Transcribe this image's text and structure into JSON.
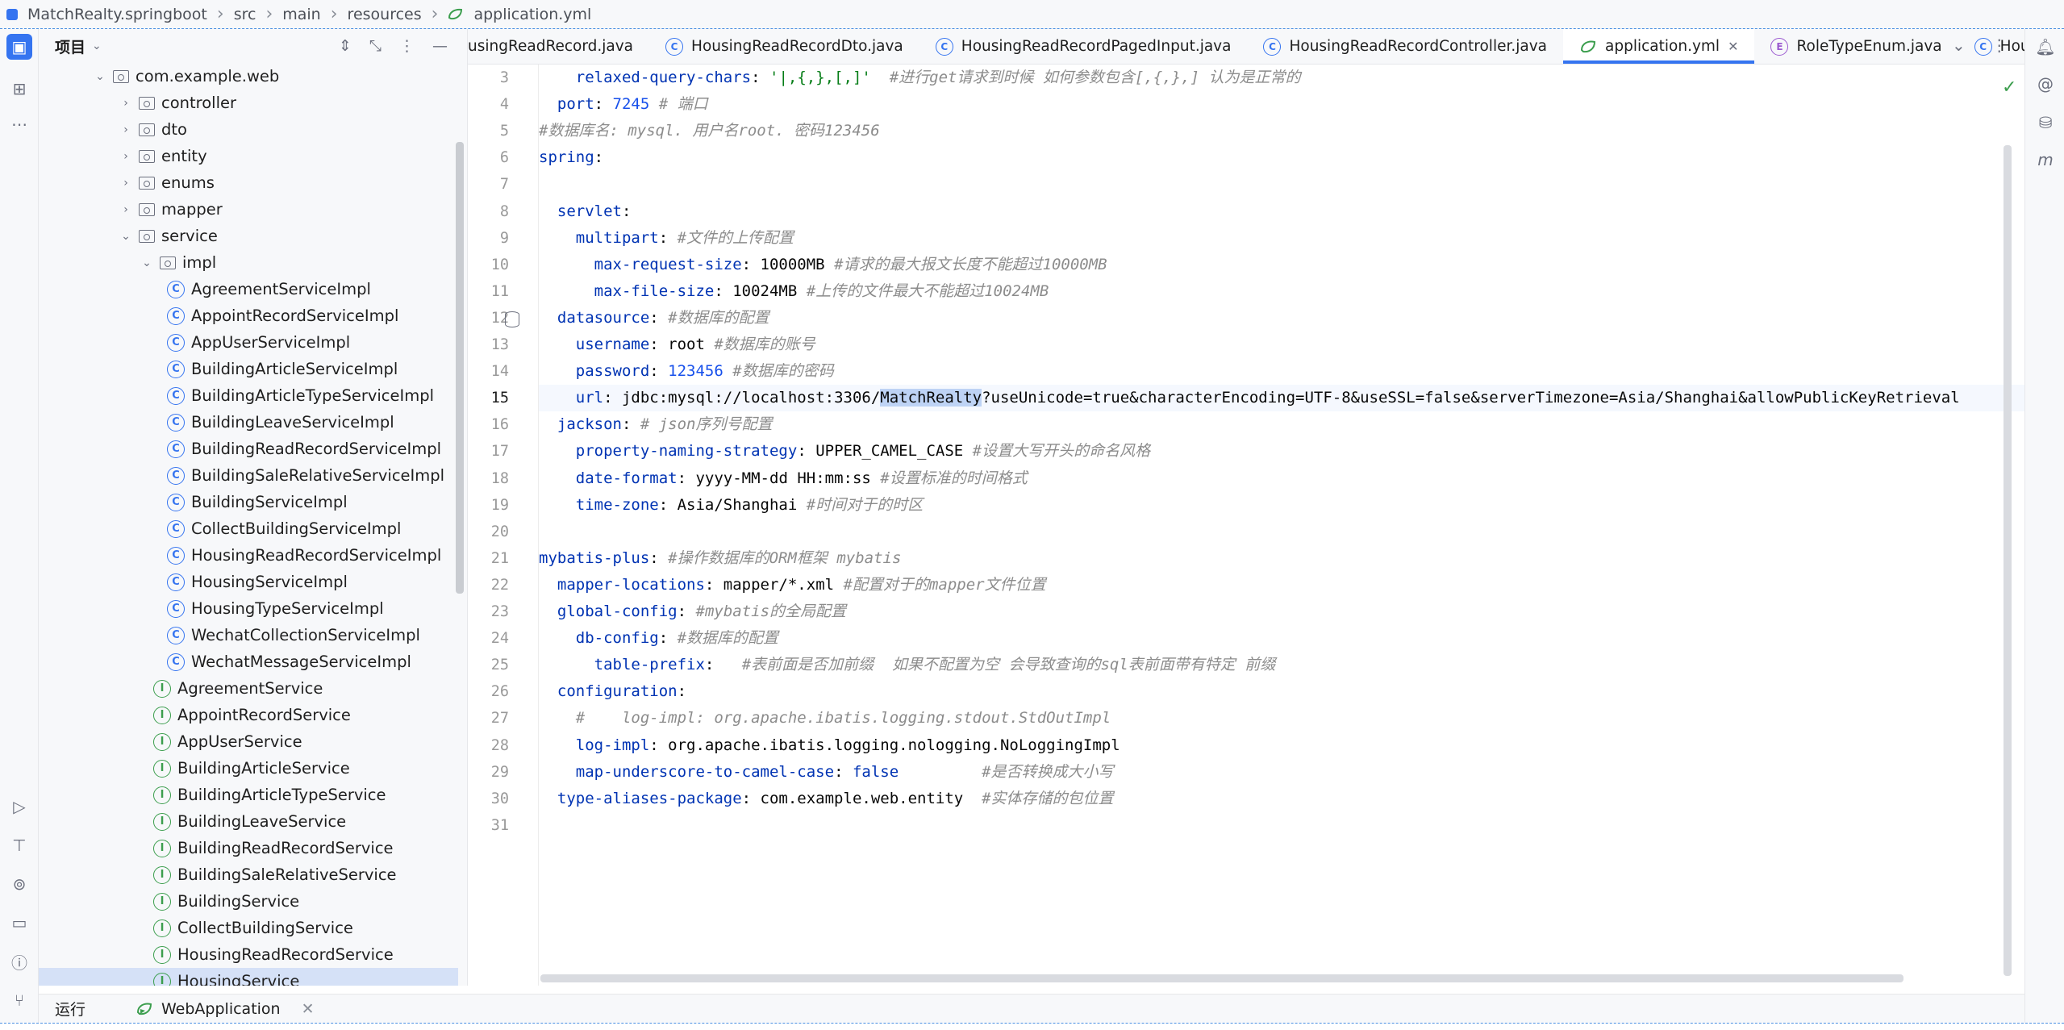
{
  "breadcrumb": [
    "MatchRealty.springboot",
    "src",
    "main",
    "resources",
    "application.yml"
  ],
  "project_panel": {
    "title": "项目",
    "tree": [
      {
        "label": "com.example.web",
        "kind": "folder",
        "depth": 0,
        "arrow": "open"
      },
      {
        "label": "controller",
        "kind": "folder",
        "depth": 1,
        "arrow": "closed"
      },
      {
        "label": "dto",
        "kind": "folder",
        "depth": 1,
        "arrow": "closed"
      },
      {
        "label": "entity",
        "kind": "folder",
        "depth": 1,
        "arrow": "closed"
      },
      {
        "label": "enums",
        "kind": "folder",
        "depth": 1,
        "arrow": "closed"
      },
      {
        "label": "mapper",
        "kind": "folder",
        "depth": 1,
        "arrow": "closed"
      },
      {
        "label": "service",
        "kind": "folder",
        "depth": 1,
        "arrow": "open"
      },
      {
        "label": "impl",
        "kind": "folder",
        "depth": 2,
        "arrow": "open"
      },
      {
        "label": "AgreementServiceImpl",
        "kind": "class",
        "depth": 3
      },
      {
        "label": "AppointRecordServiceImpl",
        "kind": "class",
        "depth": 3
      },
      {
        "label": "AppUserServiceImpl",
        "kind": "class",
        "depth": 3
      },
      {
        "label": "BuildingArticleServiceImpl",
        "kind": "class",
        "depth": 3
      },
      {
        "label": "BuildingArticleTypeServiceImpl",
        "kind": "class",
        "depth": 3
      },
      {
        "label": "BuildingLeaveServiceImpl",
        "kind": "class",
        "depth": 3
      },
      {
        "label": "BuildingReadRecordServiceImpl",
        "kind": "class",
        "depth": 3
      },
      {
        "label": "BuildingSaleRelativeServiceImpl",
        "kind": "class",
        "depth": 3
      },
      {
        "label": "BuildingServiceImpl",
        "kind": "class",
        "depth": 3
      },
      {
        "label": "CollectBuildingServiceImpl",
        "kind": "class",
        "depth": 3
      },
      {
        "label": "HousingReadRecordServiceImpl",
        "kind": "class",
        "depth": 3
      },
      {
        "label": "HousingServiceImpl",
        "kind": "class",
        "depth": 3
      },
      {
        "label": "HousingTypeServiceImpl",
        "kind": "class",
        "depth": 3
      },
      {
        "label": "WechatCollectionServiceImpl",
        "kind": "class",
        "depth": 3
      },
      {
        "label": "WechatMessageServiceImpl",
        "kind": "class",
        "depth": 3
      },
      {
        "label": "AgreementService",
        "kind": "interface",
        "depth": 2
      },
      {
        "label": "AppointRecordService",
        "kind": "interface",
        "depth": 2
      },
      {
        "label": "AppUserService",
        "kind": "interface",
        "depth": 2
      },
      {
        "label": "BuildingArticleService",
        "kind": "interface",
        "depth": 2
      },
      {
        "label": "BuildingArticleTypeService",
        "kind": "interface",
        "depth": 2
      },
      {
        "label": "BuildingLeaveService",
        "kind": "interface",
        "depth": 2
      },
      {
        "label": "BuildingReadRecordService",
        "kind": "interface",
        "depth": 2
      },
      {
        "label": "BuildingSaleRelativeService",
        "kind": "interface",
        "depth": 2
      },
      {
        "label": "BuildingService",
        "kind": "interface",
        "depth": 2
      },
      {
        "label": "CollectBuildingService",
        "kind": "interface",
        "depth": 2
      },
      {
        "label": "HousingReadRecordService",
        "kind": "interface",
        "depth": 2
      },
      {
        "label": "HousingService",
        "kind": "interface",
        "depth": 2
      }
    ]
  },
  "tabs": [
    {
      "label": "usingReadRecord.java",
      "icon": "none",
      "active": false
    },
    {
      "label": "HousingReadRecordDto.java",
      "icon": "class",
      "active": false
    },
    {
      "label": "HousingReadRecordPagedInput.java",
      "icon": "class",
      "active": false
    },
    {
      "label": "HousingReadRecordController.java",
      "icon": "class",
      "active": false
    },
    {
      "label": "application.yml",
      "icon": "yml",
      "active": true
    },
    {
      "label": "RoleTypeEnum.java",
      "icon": "enum",
      "active": false
    },
    {
      "label": "HousingController.java",
      "icon": "class",
      "active": false
    }
  ],
  "editor": {
    "current_line": 15,
    "lines": [
      {
        "n": "3",
        "parts": [
          [
            "    ",
            ""
          ],
          [
            "relaxed-query-chars",
            "k"
          ],
          [
            ": ",
            ""
          ],
          [
            "'|,{,},[,]'",
            "s"
          ],
          [
            "  ",
            ""
          ],
          [
            "#进行get请求到时候 如何参数包含[,{,},] 认为是正常的",
            "c"
          ]
        ]
      },
      {
        "n": "4",
        "parts": [
          [
            "  ",
            ""
          ],
          [
            "port",
            "k"
          ],
          [
            ": ",
            ""
          ],
          [
            "7245",
            "n"
          ],
          [
            " ",
            ""
          ],
          [
            "# 端口",
            "c"
          ]
        ]
      },
      {
        "n": "5",
        "parts": [
          [
            "#数据库名: mysql. 用户名root. 密码123456",
            "c"
          ]
        ]
      },
      {
        "n": "6",
        "parts": [
          [
            "spring",
            "k"
          ],
          [
            ":",
            ""
          ]
        ]
      },
      {
        "n": "7",
        "parts": [
          [
            "",
            ""
          ]
        ]
      },
      {
        "n": "8",
        "parts": [
          [
            "  ",
            ""
          ],
          [
            "servlet",
            "k"
          ],
          [
            ":",
            ""
          ]
        ]
      },
      {
        "n": "9",
        "parts": [
          [
            "    ",
            ""
          ],
          [
            "multipart",
            "k"
          ],
          [
            ": ",
            ""
          ],
          [
            "#文件的上传配置",
            "c"
          ]
        ]
      },
      {
        "n": "10",
        "parts": [
          [
            "      ",
            ""
          ],
          [
            "max-request-size",
            "k"
          ],
          [
            ": 10000MB ",
            ""
          ],
          [
            "#请求的最大报文长度不能超过10000MB",
            "c"
          ]
        ]
      },
      {
        "n": "11",
        "parts": [
          [
            "      ",
            ""
          ],
          [
            "max-file-size",
            "k"
          ],
          [
            ": 10024MB ",
            ""
          ],
          [
            "#上传的文件最大不能超过10024MB",
            "c"
          ]
        ]
      },
      {
        "n": "12",
        "parts": [
          [
            "  ",
            ""
          ],
          [
            "datasource",
            "k"
          ],
          [
            ": ",
            ""
          ],
          [
            "#数据库的配置",
            "c"
          ]
        ]
      },
      {
        "n": "13",
        "parts": [
          [
            "    ",
            ""
          ],
          [
            "username",
            "k"
          ],
          [
            ": root ",
            ""
          ],
          [
            "#数据库的账号",
            "c"
          ]
        ]
      },
      {
        "n": "14",
        "parts": [
          [
            "    ",
            ""
          ],
          [
            "password",
            "k"
          ],
          [
            ": ",
            ""
          ],
          [
            "123456",
            "n"
          ],
          [
            " ",
            ""
          ],
          [
            "#数据库的密码",
            "c"
          ]
        ]
      },
      {
        "n": "15",
        "parts": [
          [
            "    ",
            ""
          ],
          [
            "url",
            "k"
          ],
          [
            ": jdbc:mysql://localhost:3306/",
            ""
          ],
          [
            "MatchRealty",
            "hl"
          ],
          [
            "?useUnicode=true&characterEncoding=UTF-8&useSSL=false&serverTimezone=Asia/Shanghai&allowPublicKeyRetrieval",
            ""
          ]
        ]
      },
      {
        "n": "16",
        "parts": [
          [
            "  ",
            ""
          ],
          [
            "jackson",
            "k"
          ],
          [
            ": ",
            ""
          ],
          [
            "# json序列号配置",
            "c"
          ]
        ]
      },
      {
        "n": "17",
        "parts": [
          [
            "    ",
            ""
          ],
          [
            "property-naming-strategy",
            "k"
          ],
          [
            ": UPPER_CAMEL_CASE ",
            ""
          ],
          [
            "#设置大写开头的命名风格",
            "c"
          ]
        ]
      },
      {
        "n": "18",
        "parts": [
          [
            "    ",
            ""
          ],
          [
            "date-format",
            "k"
          ],
          [
            ": yyyy-MM-dd HH:mm:ss ",
            ""
          ],
          [
            "#设置标准的时间格式",
            "c"
          ]
        ]
      },
      {
        "n": "19",
        "parts": [
          [
            "    ",
            ""
          ],
          [
            "time-zone",
            "k"
          ],
          [
            ": Asia/Shanghai ",
            ""
          ],
          [
            "#时间对于的时区",
            "c"
          ]
        ]
      },
      {
        "n": "20",
        "parts": [
          [
            "",
            ""
          ]
        ]
      },
      {
        "n": "21",
        "parts": [
          [
            "mybatis-plus",
            "k"
          ],
          [
            ": ",
            ""
          ],
          [
            "#操作数据库的ORM框架 mybatis",
            "c"
          ]
        ]
      },
      {
        "n": "22",
        "parts": [
          [
            "  ",
            ""
          ],
          [
            "mapper-locations",
            "k"
          ],
          [
            ": mapper/*.xml ",
            ""
          ],
          [
            "#配置对于的mapper文件位置",
            "c"
          ]
        ]
      },
      {
        "n": "23",
        "parts": [
          [
            "  ",
            ""
          ],
          [
            "global-config",
            "k"
          ],
          [
            ": ",
            ""
          ],
          [
            "#mybatis的全局配置",
            "c"
          ]
        ]
      },
      {
        "n": "24",
        "parts": [
          [
            "    ",
            ""
          ],
          [
            "db-config",
            "k"
          ],
          [
            ": ",
            ""
          ],
          [
            "#数据库的配置",
            "c"
          ]
        ]
      },
      {
        "n": "25",
        "parts": [
          [
            "      ",
            ""
          ],
          [
            "table-prefix",
            "k"
          ],
          [
            ":   ",
            ""
          ],
          [
            "#表前面是否加前缀  如果不配置为空 会导致查询的sql表前面带有特定 前缀",
            "c"
          ]
        ]
      },
      {
        "n": "26",
        "parts": [
          [
            "  ",
            ""
          ],
          [
            "configuration",
            "k"
          ],
          [
            ":",
            ""
          ]
        ]
      },
      {
        "n": "27",
        "parts": [
          [
            "    ",
            ""
          ],
          [
            "#    log-impl: org.apache.ibatis.logging.stdout.StdOutImpl",
            "c"
          ]
        ]
      },
      {
        "n": "28",
        "parts": [
          [
            "    ",
            ""
          ],
          [
            "log-impl",
            "k"
          ],
          [
            ": org.apache.ibatis.logging.nologging.NoLoggingImpl",
            ""
          ]
        ]
      },
      {
        "n": "29",
        "parts": [
          [
            "    ",
            ""
          ],
          [
            "map-underscore-to-camel-case",
            "k"
          ],
          [
            ": ",
            ""
          ],
          [
            "false",
            "k"
          ],
          [
            "         ",
            ""
          ],
          [
            "#是否转换成大小写",
            "c"
          ]
        ]
      },
      {
        "n": "30",
        "parts": [
          [
            "  ",
            ""
          ],
          [
            "type-aliases-package",
            "k"
          ],
          [
            ": com.example.web.entity  ",
            ""
          ],
          [
            "#实体存储的包位置",
            "c"
          ]
        ]
      },
      {
        "n": "31",
        "parts": [
          [
            "",
            ""
          ]
        ]
      }
    ]
  },
  "run_bar": {
    "label": "运行",
    "config": "WebApplication"
  },
  "colors": {
    "accent": "#3574f0",
    "keyword": "#0033b3",
    "string": "#067d17",
    "number": "#1750eb",
    "comment": "#8c8c8c"
  }
}
